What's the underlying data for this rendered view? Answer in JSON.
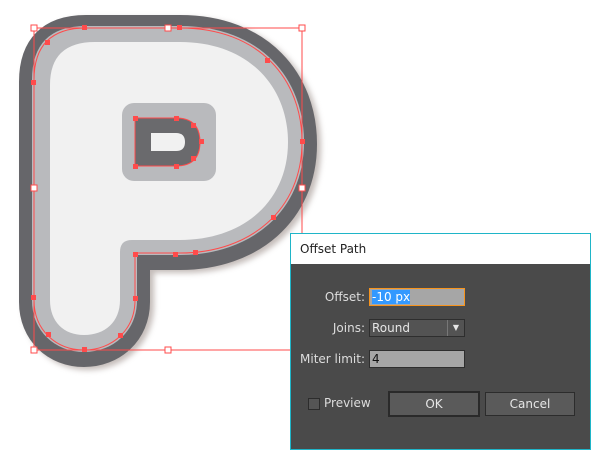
{
  "dialog": {
    "title": "Offset Path",
    "offset_label": "Offset:",
    "offset_value": "-10 px",
    "joins_label": "Joins:",
    "joins_value": "Round",
    "miter_label": "Miter limit:",
    "miter_value": "4",
    "preview_label": "Preview",
    "preview_checked": false,
    "ok_label": "OK",
    "cancel_label": "Cancel"
  },
  "colors": {
    "selection": "#ff4b4b",
    "accent": "#1fb5c8",
    "focus": "#f7941d"
  }
}
